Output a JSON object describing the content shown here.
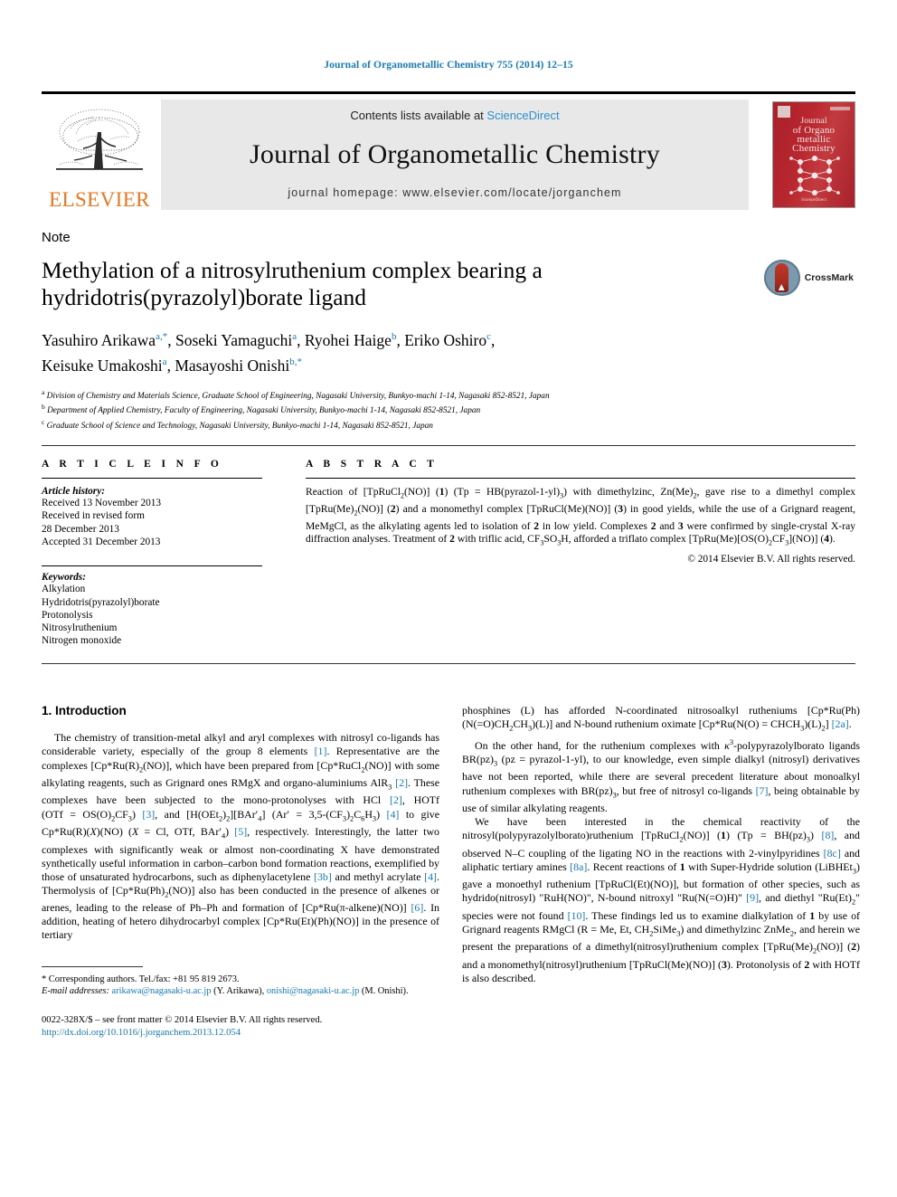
{
  "running_head": "Journal of Organometallic Chemistry 755 (2014) 12–15",
  "masthead": {
    "contents_prefix": "Contents lists available at ",
    "sciencedirect": "ScienceDirect",
    "journal_title": "Journal of Organometallic Chemistry",
    "homepage": "journal homepage: www.elsevier.com/locate/jorganchem",
    "publisher_name": "ELSEVIER",
    "cover": {
      "line1": "Journal",
      "line2": "of Organo",
      "line3": "metallic",
      "line4": "Chemistry",
      "footer": "ScienceDirect"
    },
    "accent_blue": "#1a7bb9",
    "elsevier_orange": "#E87722",
    "cover_red": "#b0242c"
  },
  "article": {
    "type": "Note",
    "title": "Methylation of a nitrosylruthenium complex bearing a hydridotris(pyrazolyl)borate ligand",
    "crossmark_label": "CrossMark",
    "authors_line1": "Yasuhiro Arikawa",
    "authors_html": "Yasuhiro Arikawa a,*, Soseki Yamaguchi a, Ryohei Haige b, Eriko Oshiro c, Keisuke Umakoshi a, Masayoshi Onishi b,*",
    "affiliations": [
      "Division of Chemistry and Materials Science, Graduate School of Engineering, Nagasaki University, Bunkyo-machi 1-14, Nagasaki 852-8521, Japan",
      "Department of Applied Chemistry, Faculty of Engineering, Nagasaki University, Bunkyo-machi 1-14, Nagasaki 852-8521, Japan",
      "Graduate School of Science and Technology, Nagasaki University, Bunkyo-machi 1-14, Nagasaki 852-8521, Japan"
    ],
    "affil_marks": [
      "a",
      "b",
      "c"
    ]
  },
  "article_info": {
    "heading": "A R T I C L E  I N F O",
    "history_label": "Article history:",
    "history": [
      "Received 13 November 2013",
      "Received in revised form",
      "28 December 2013",
      "Accepted 31 December 2013"
    ],
    "keywords_label": "Keywords:",
    "keywords": [
      "Alkylation",
      "Hydridotris(pyrazolyl)borate",
      "Protonolysis",
      "Nitrosylruthenium",
      "Nitrogen monoxide"
    ]
  },
  "abstract": {
    "heading": "A B S T R A C T",
    "copyright": "© 2014 Elsevier B.V. All rights reserved."
  },
  "intro": {
    "heading": "1. Introduction"
  },
  "footnote": {
    "corresponding": "* Corresponding authors. Tel./fax: +81 95 819 2673.",
    "email_label": "E-mail addresses:",
    "email1": "arikawa@nagasaki-u.ac.jp",
    "email1_name": "(Y. Arikawa),",
    "email2": "onishi@nagasaki-u.ac.jp",
    "email2_name": "(M. Onishi)."
  },
  "imprint": {
    "issn_line": "0022-328X/$ – see front matter © 2014 Elsevier B.V. All rights reserved.",
    "doi": "http://dx.doi.org/10.1016/j.jorganchem.2013.12.054"
  }
}
